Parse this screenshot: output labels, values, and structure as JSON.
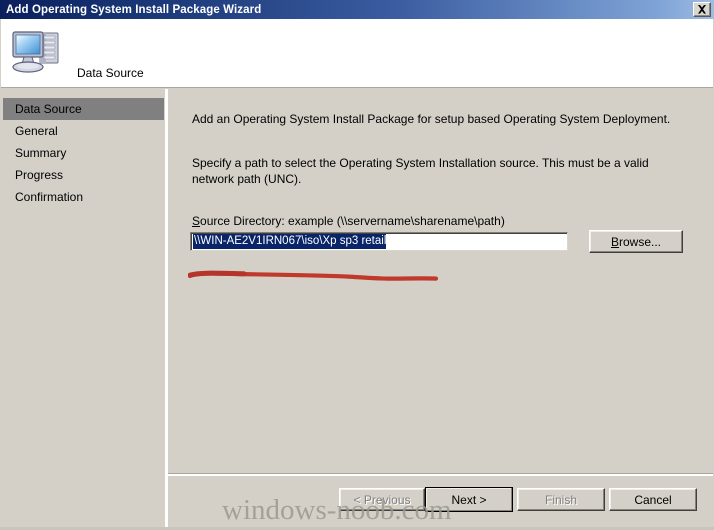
{
  "window": {
    "title": "Add Operating System Install Package Wizard",
    "close_icon": "close-icon",
    "close_glyph": "X"
  },
  "header": {
    "icon": "computer-icon",
    "page_title": "Data Source"
  },
  "sidebar": {
    "items": [
      {
        "label": "Data Source",
        "selected": true
      },
      {
        "label": "General",
        "selected": false
      },
      {
        "label": "Summary",
        "selected": false
      },
      {
        "label": "Progress",
        "selected": false
      },
      {
        "label": "Confirmation",
        "selected": false
      }
    ]
  },
  "content": {
    "intro_text": "Add an Operating System Install Package for setup based Operating System Deployment.",
    "specify_text": "Specify a path to select the Operating System Installation source. This must be a valid network path (UNC).",
    "source_label_accel": "S",
    "source_label_rest": "ource Directory: example (\\\\servername\\sharename\\path)",
    "source_input": {
      "value": "\\\\WIN-AE2V1IRN067\\iso\\Xp sp3 retail",
      "placeholder": "",
      "selected": true
    },
    "browse_accel": "B",
    "browse_rest": "rowse...",
    "annotation": {
      "type": "red-underline-scribble",
      "color": "#c0392b"
    }
  },
  "footer": {
    "buttons": [
      {
        "name": "previous",
        "label": "< Previous",
        "disabled": true,
        "focused": false
      },
      {
        "name": "next",
        "label": "Next >",
        "disabled": false,
        "focused": true
      },
      {
        "name": "finish",
        "label": "Finish",
        "disabled": true,
        "focused": false
      },
      {
        "name": "cancel",
        "label": "Cancel",
        "disabled": false,
        "focused": false
      }
    ]
  },
  "watermark": {
    "text": "windows-noob.com"
  },
  "colors": {
    "titlebar_start": "#0b1f5c",
    "titlebar_end": "#9fbce3",
    "dialog_face": "#d4d0c8",
    "selection_blue": "#0a246a",
    "sidebar_selected": "#808080",
    "annotation_red": "#c0392b"
  }
}
